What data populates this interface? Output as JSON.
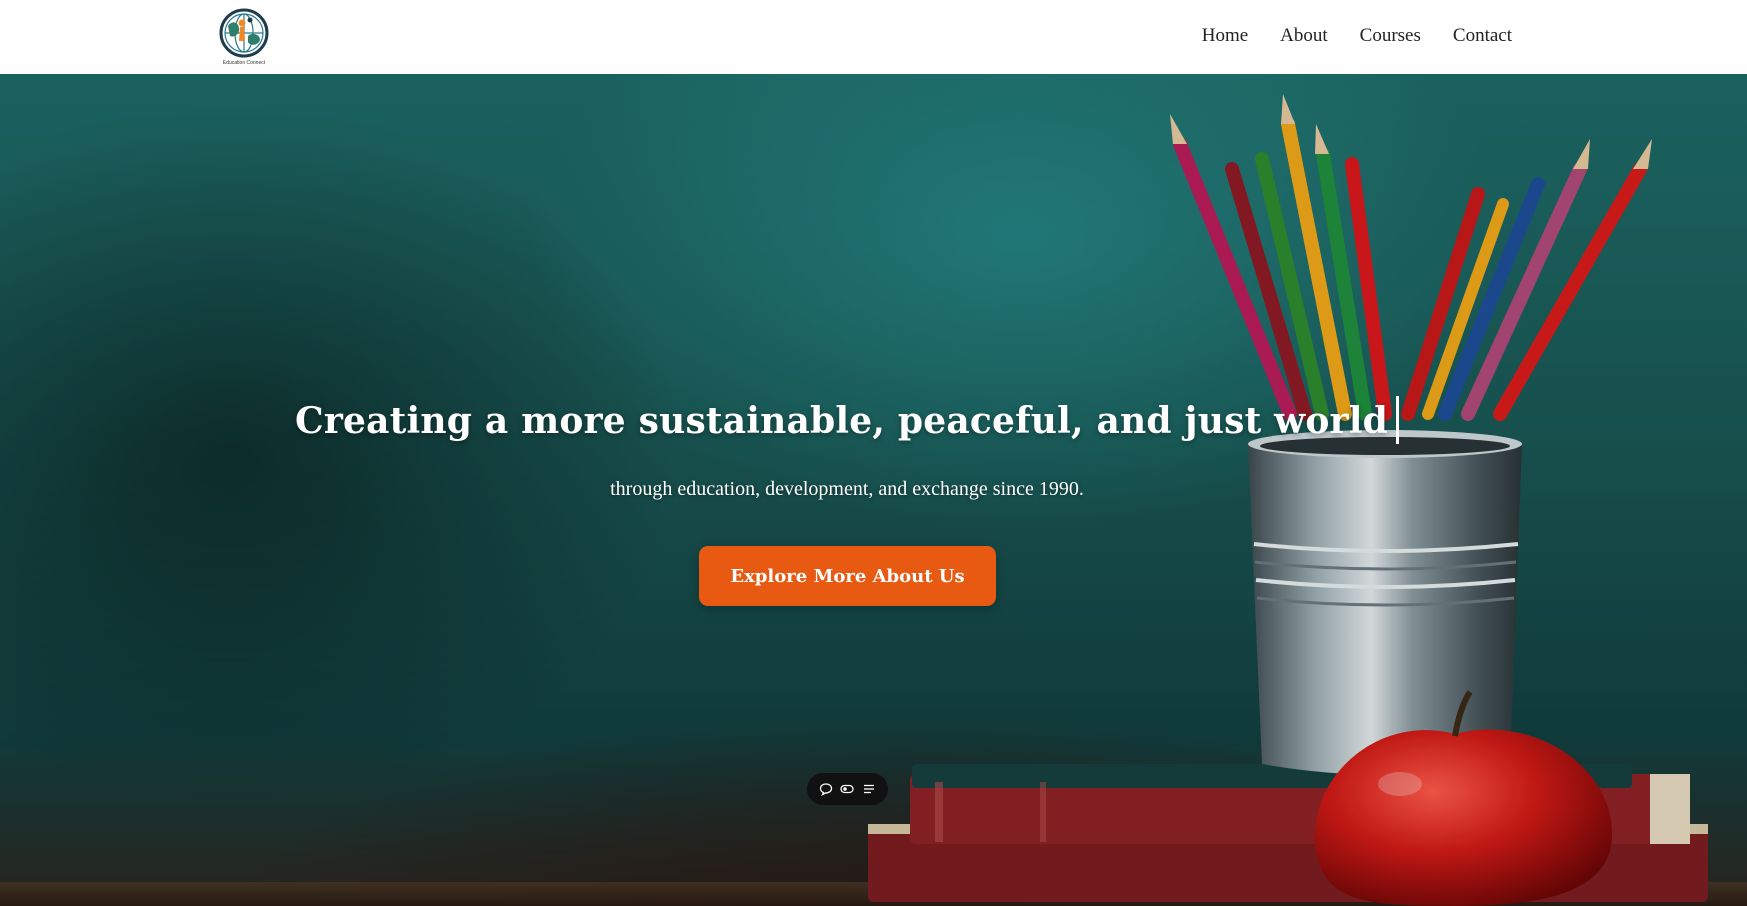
{
  "header": {
    "logo_text": "Education Connect",
    "nav": [
      {
        "label": "Home"
      },
      {
        "label": "About"
      },
      {
        "label": "Courses"
      },
      {
        "label": "Contact"
      }
    ]
  },
  "hero": {
    "headline": "Creating a more sustainable, peaceful, and just world",
    "subline": "through education, development, and exchange since 1990.",
    "cta_label": "Explore More About Us",
    "background_image": "chalkboard with pencils in a tin cup, books and a red apple"
  },
  "mini_toolbar": {
    "icons": [
      "chat-bubble-icon",
      "toggle-icon",
      "menu-list-icon"
    ]
  },
  "colors": {
    "accent": "#e85a12",
    "header_bg": "#ffffff",
    "nav_text": "#222222",
    "hero_text": "#ffffff",
    "chalkboard": "#1a5956"
  }
}
